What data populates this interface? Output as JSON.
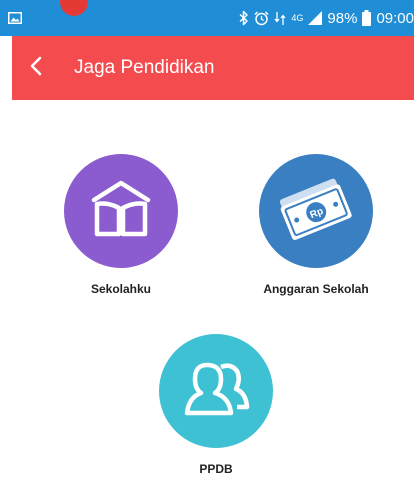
{
  "status_bar": {
    "network": "4G",
    "battery": "98%",
    "time": "09:00",
    "bar_color": "#1f8ed6",
    "icons": [
      "image-icon",
      "bluetooth-icon",
      "alarm-icon",
      "data-sync-icon",
      "network-4g-icon",
      "signal-icon",
      "battery-icon"
    ]
  },
  "app_bar": {
    "title": "Jaga Pendidikan",
    "back_icon": "chevron-left-icon",
    "color": "#f44b4f"
  },
  "menu": {
    "items": [
      {
        "label": "Sekolahku",
        "icon": "open-book-house-icon",
        "color": "#8b5ccf"
      },
      {
        "label": "Anggaran Sekolah",
        "icon": "money-rupiah-icon",
        "color": "#3a7fc1"
      },
      {
        "label": "PPDB",
        "icon": "users-icon",
        "color": "#3fc1d4"
      }
    ]
  }
}
